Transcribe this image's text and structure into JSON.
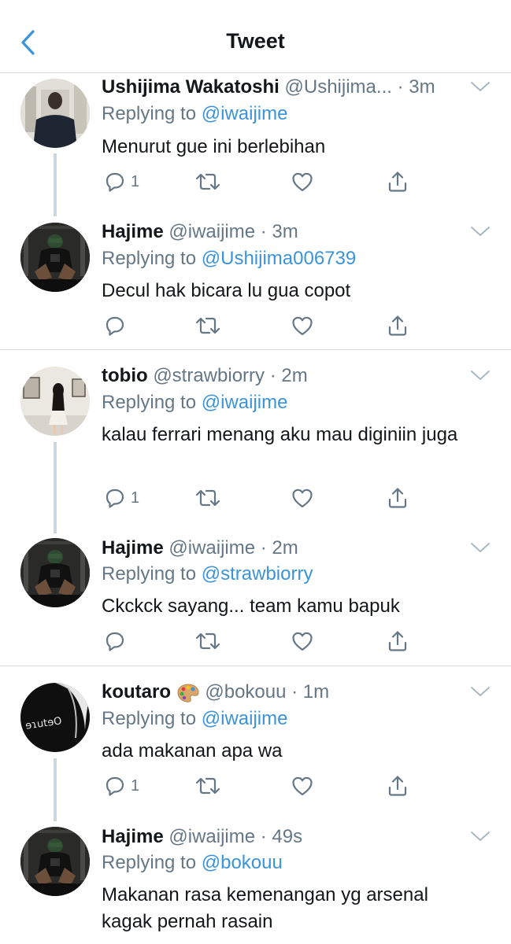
{
  "header": {
    "title": "Tweet",
    "back_icon": "chevron-left-icon"
  },
  "colors": {
    "accent": "#3b94d9",
    "secondary": "#657786",
    "text": "#14171a",
    "divider": "#d6dadd",
    "thread": "#ccd6dd"
  },
  "tweets": [
    {
      "name": "Ushijima Wakatoshi",
      "handle": "@Ushijima...",
      "time": " · 3m",
      "replying_prefix": "Replying to ",
      "replying_to": "@iwaijime",
      "text": "Menurut gue ini berlebihan",
      "reply_count": "1"
    },
    {
      "name": "Hajime",
      "handle": "@iwaijime",
      "time": " · 3m",
      "replying_prefix": "Replying to ",
      "replying_to": "@Ushijima006739",
      "text": "Decul hak bicara lu gua copot",
      "reply_count": ""
    },
    {
      "name": "tobio",
      "handle": "@strawbiorry",
      "time": " · 2m",
      "replying_prefix": "Replying to ",
      "replying_to": "@iwaijime",
      "text": "kalau ferrari menang aku mau diginiin juga",
      "reply_count": "1"
    },
    {
      "name": "Hajime",
      "handle": "@iwaijime",
      "time": " · 2m",
      "replying_prefix": "Replying to ",
      "replying_to": "@strawbiorry",
      "text": "Ckckck sayang... team kamu bapuk",
      "reply_count": ""
    },
    {
      "name": "koutaro",
      "name_emoji": "artist-palette-icon",
      "handle": "@bokouu",
      "time": " · 1m",
      "replying_prefix": "Replying to ",
      "replying_to": "@iwaijime",
      "text": "ada makanan apa wa",
      "reply_count": "1"
    },
    {
      "name": "Hajime",
      "handle": "@iwaijime",
      "time": " · 49s",
      "replying_prefix": "Replying to ",
      "replying_to": "@bokouu",
      "text": "Makanan rasa kemenangan yg arsenal kagak pernah rasain",
      "reply_count": ""
    }
  ]
}
